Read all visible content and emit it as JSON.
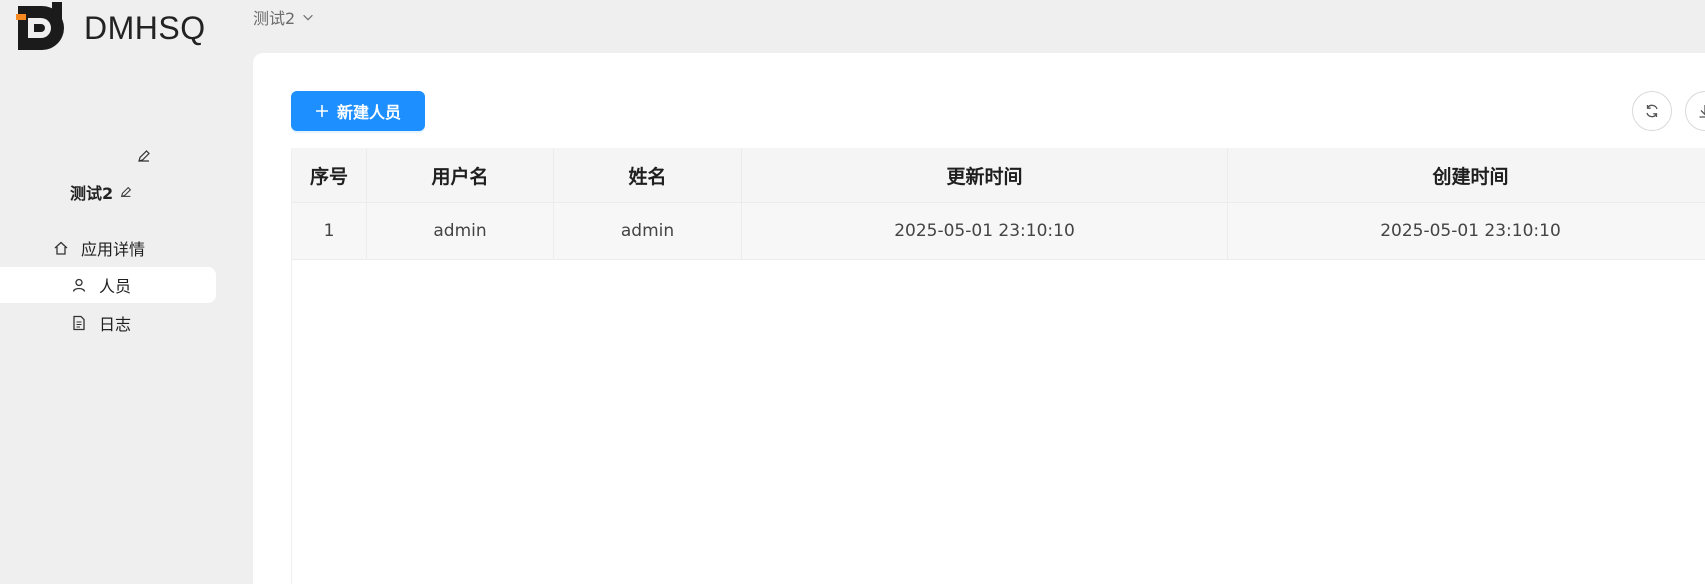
{
  "brand": {
    "name": "DMHSQ",
    "accent_color": "#f5881f",
    "logo_color": "#1b1b1b"
  },
  "sidebar": {
    "app_name": "测试2",
    "items": [
      {
        "label": "应用详情",
        "icon": "home-icon",
        "active": false
      },
      {
        "label": "人员",
        "icon": "user-icon",
        "active": true
      },
      {
        "label": "日志",
        "icon": "file-text-icon",
        "active": false
      }
    ]
  },
  "header": {
    "breadcrumb": "测试2",
    "breadcrumb_icon": "chevron-down-icon"
  },
  "toolbar": {
    "new_button_label": "新建人员",
    "new_button_icon": "plus-icon",
    "primary_color": "#1d8fff",
    "actions": [
      "refresh-icon",
      "download-icon"
    ]
  },
  "table": {
    "columns": [
      "序号",
      "用户名",
      "姓名",
      "更新时间",
      "创建时间"
    ],
    "rows": [
      [
        "1",
        "admin",
        "admin",
        "2025-05-01 23:10:10",
        "2025-05-01 23:10:10"
      ]
    ]
  }
}
